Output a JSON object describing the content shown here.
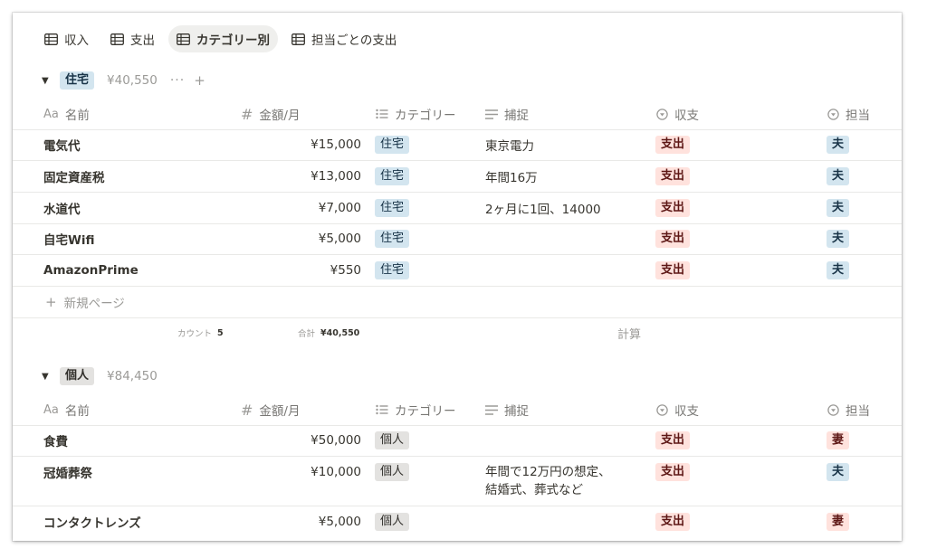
{
  "tabs": [
    {
      "label": "収入",
      "active": false
    },
    {
      "label": "支出",
      "active": false
    },
    {
      "label": "カテゴリー別",
      "active": true
    },
    {
      "label": "担当ごとの支出",
      "active": false
    }
  ],
  "columns": {
    "name": "名前",
    "name_icon": "Aa",
    "amount": "金額/月",
    "amount_icon": "#",
    "category": "カテゴリー",
    "note": "捕捉",
    "type": "収支",
    "owner": "担当"
  },
  "groups": [
    {
      "label": "住宅",
      "sum": "¥40,550",
      "more": "···",
      "add": "+",
      "rows": [
        {
          "name": "電気代",
          "amount": "¥15,000",
          "category": "住宅",
          "note": "東京電力",
          "note2": "",
          "type": "支出",
          "owner": "夫"
        },
        {
          "name": "固定資産税",
          "amount": "¥13,000",
          "category": "住宅",
          "note": "年間16万",
          "note2": "",
          "type": "支出",
          "owner": "夫"
        },
        {
          "name": "水道代",
          "amount": "¥7,000",
          "category": "住宅",
          "note": "2ヶ月に1回、14000",
          "note2": "",
          "type": "支出",
          "owner": "夫"
        },
        {
          "name": "自宅Wifi",
          "amount": "¥5,000",
          "category": "住宅",
          "note": "",
          "note2": "",
          "type": "支出",
          "owner": "夫"
        },
        {
          "name": "AmazonPrime",
          "amount": "¥550",
          "category": "住宅",
          "note": "",
          "note2": "",
          "type": "支出",
          "owner": "夫"
        }
      ],
      "new_page": "新規ページ",
      "new_page_icon": "+",
      "footer": {
        "count_label": "カウント",
        "count_value": "5",
        "sum_label": "合計",
        "sum_value": "¥40,550",
        "calc": "計算"
      }
    },
    {
      "label": "個人",
      "sum": "¥84,450",
      "rows": [
        {
          "name": "食費",
          "amount": "¥50,000",
          "category": "個人",
          "note": "",
          "note2": "",
          "type": "支出",
          "owner": "妻"
        },
        {
          "name": "冠婚葬祭",
          "amount": "¥10,000",
          "category": "個人",
          "note": "年間で12万円の想定、",
          "note2": "結婚式、葬式など",
          "type": "支出",
          "owner": "夫"
        },
        {
          "name": "コンタクトレンズ",
          "amount": "¥5,000",
          "category": "個人",
          "note": "",
          "note2": "",
          "type": "支出",
          "owner": "妻"
        }
      ]
    }
  ],
  "colors": {
    "tag_blue": "#d3e5ef",
    "tag_gray": "#e3e2e0",
    "tag_red": "#ffe2dd",
    "active_tab_bg": "#efefed"
  }
}
